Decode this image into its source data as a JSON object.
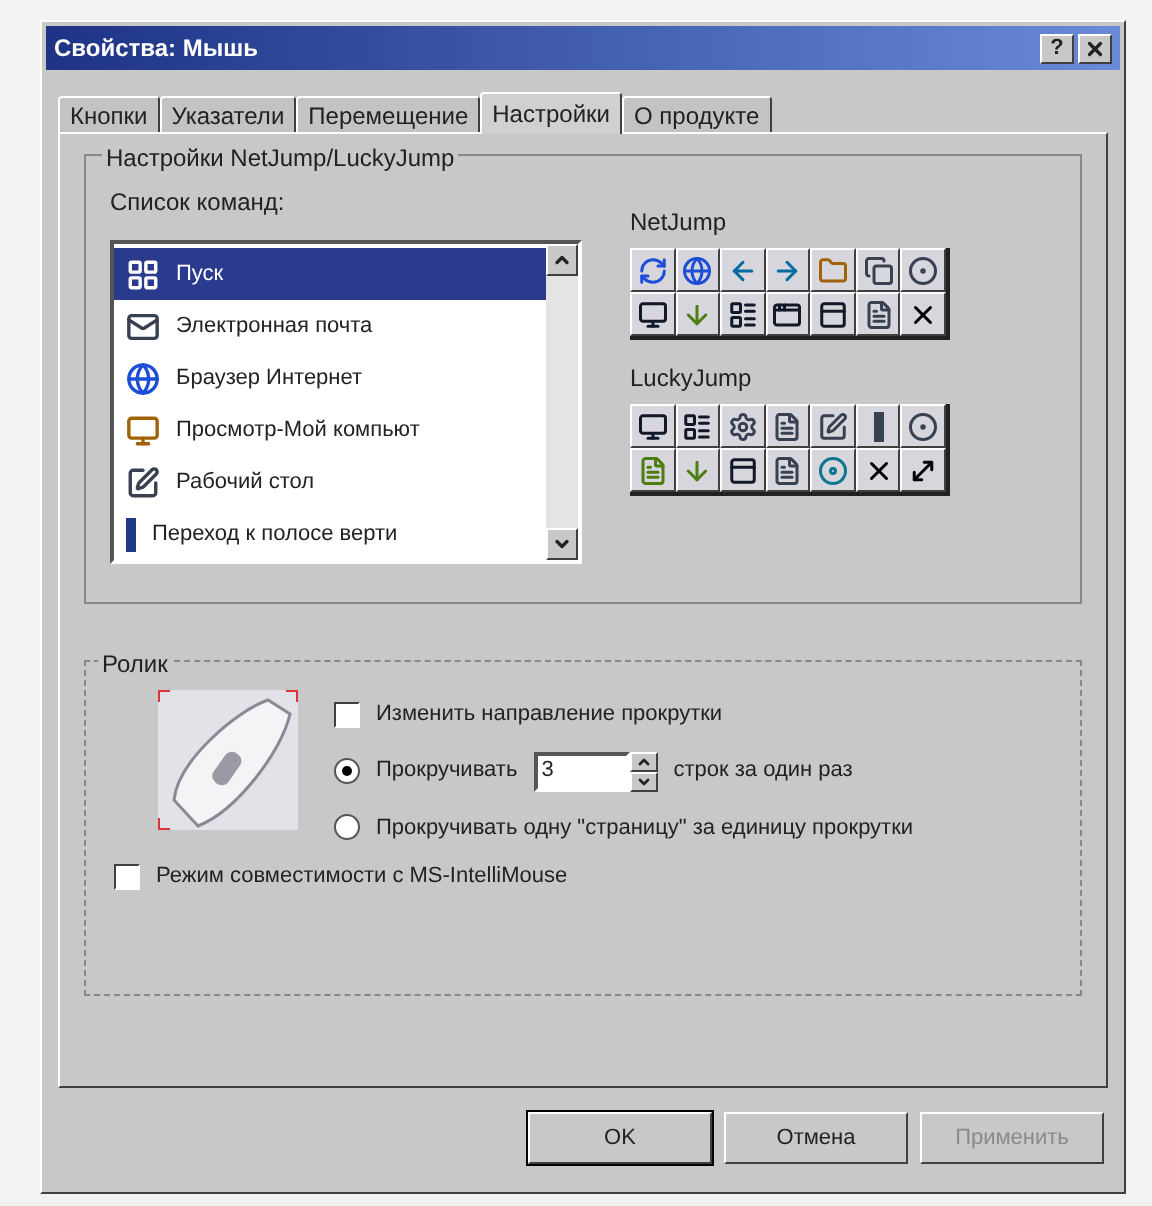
{
  "window": {
    "title": "Свойства: Мышь",
    "help_button": "?"
  },
  "tabs": [
    {
      "label": "Кнопки",
      "selected": false
    },
    {
      "label": "Указатели",
      "selected": false
    },
    {
      "label": "Перемещение",
      "selected": false
    },
    {
      "label": "Настройки",
      "selected": true
    },
    {
      "label": "О продукте",
      "selected": false
    }
  ],
  "jump_group": {
    "title": "Настройки NetJump/LuckyJump",
    "commands_label": "Список команд:",
    "commands": [
      {
        "label": "Пуск",
        "selected": true
      },
      {
        "label": "Электронная почта",
        "selected": false
      },
      {
        "label": "Браузер Интернет",
        "selected": false
      },
      {
        "label": "Просмотр-Мой компьют",
        "selected": false
      },
      {
        "label": "Рабочий стол",
        "selected": false
      },
      {
        "label": "Переход к полосе верти",
        "selected": false
      }
    ],
    "toolbars": [
      {
        "label": "NetJump"
      },
      {
        "label": "LuckyJump"
      }
    ]
  },
  "wheel_group": {
    "title": "Ролик",
    "options": [
      {
        "kind": "checkbox",
        "label": "Изменить направление прокрутки",
        "checked": false
      },
      {
        "kind": "spin",
        "label": "Прокручивать",
        "selected": true,
        "value": "3",
        "suffix": "строк за один раз"
      },
      {
        "kind": "radio",
        "label": "Прокручивать одну \"страницу\" за единицу прокрутки",
        "selected": false
      },
      {
        "kind": "checkbox",
        "label": "Режим совместимости с MS-IntelliMouse",
        "checked": false
      }
    ]
  },
  "buttons": [
    {
      "label": "OK",
      "disabled": false
    },
    {
      "label": "Отмена",
      "disabled": false
    },
    {
      "label": "Применить",
      "disabled": true
    }
  ]
}
